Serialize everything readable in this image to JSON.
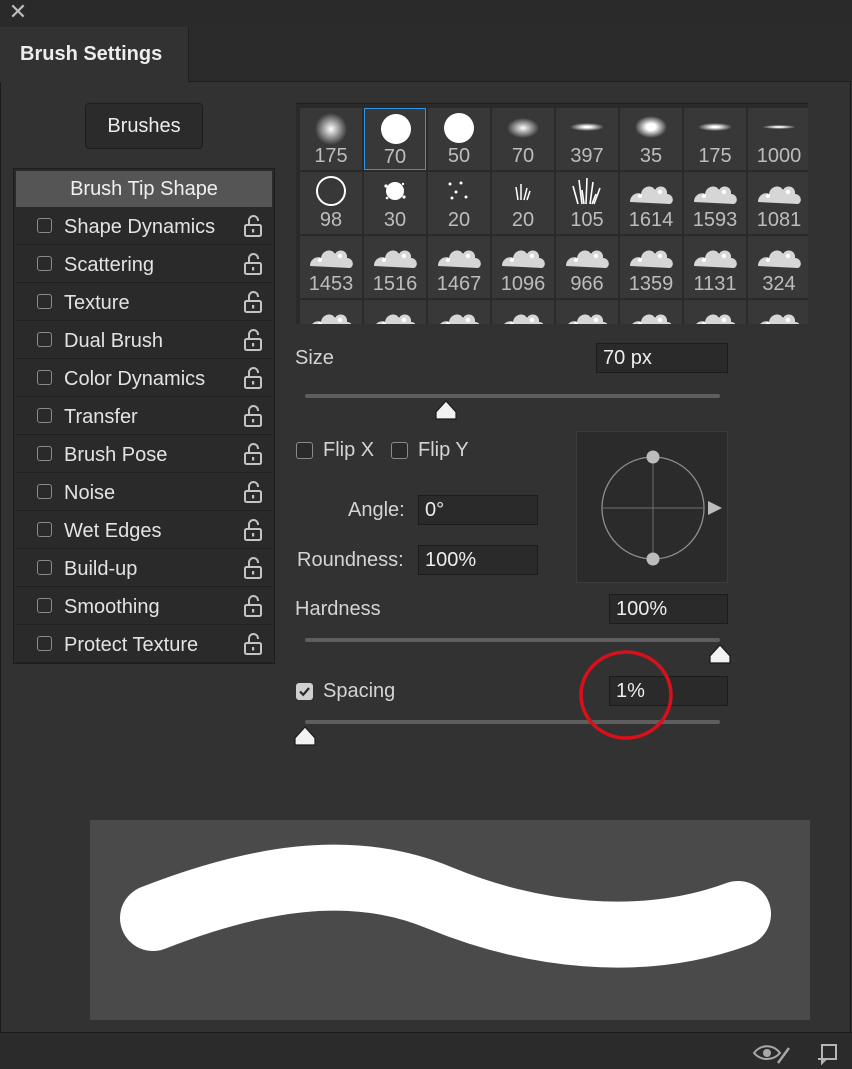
{
  "window": {
    "close_glyph": "✕",
    "tab_title": "Brush Settings"
  },
  "brushes_button": "Brushes",
  "options_list": [
    {
      "label": "Brush Tip Shape",
      "checkbox": false,
      "lock": false,
      "selected": true
    },
    {
      "label": "Shape Dynamics",
      "checkbox": true,
      "lock": true
    },
    {
      "label": "Scattering",
      "checkbox": true,
      "lock": true
    },
    {
      "label": "Texture",
      "checkbox": true,
      "lock": true
    },
    {
      "label": "Dual Brush",
      "checkbox": true,
      "lock": true
    },
    {
      "label": "Color Dynamics",
      "checkbox": true,
      "lock": true
    },
    {
      "label": "Transfer",
      "checkbox": true,
      "lock": true
    },
    {
      "label": "Brush Pose",
      "checkbox": true,
      "lock": true
    },
    {
      "label": "Noise",
      "checkbox": true,
      "lock": true
    },
    {
      "label": "Wet Edges",
      "checkbox": true,
      "lock": true
    },
    {
      "label": "Build-up",
      "checkbox": true,
      "lock": true
    },
    {
      "label": "Smoothing",
      "checkbox": true,
      "lock": true
    },
    {
      "label": "Protect Texture",
      "checkbox": true,
      "lock": true
    }
  ],
  "presets": [
    {
      "size": "175",
      "tip": "soft"
    },
    {
      "size": "70",
      "tip": "hard",
      "selected": true
    },
    {
      "size": "50",
      "tip": "hard"
    },
    {
      "size": "70",
      "tip": "soft-ellipse"
    },
    {
      "size": "397",
      "tip": "flat"
    },
    {
      "size": "35",
      "tip": "soft-ellipse-bright"
    },
    {
      "size": "175",
      "tip": "flat"
    },
    {
      "size": "1000",
      "tip": "flat-thin"
    },
    {
      "size": "98",
      "tip": "ring"
    },
    {
      "size": "30",
      "tip": "splatter"
    },
    {
      "size": "20",
      "tip": "dots"
    },
    {
      "size": "20",
      "tip": "grass-small"
    },
    {
      "size": "105",
      "tip": "grass"
    },
    {
      "size": "1614",
      "tip": "cloud"
    },
    {
      "size": "1593",
      "tip": "cloud"
    },
    {
      "size": "1081",
      "tip": "cloud"
    },
    {
      "size": "1453",
      "tip": "cloud"
    },
    {
      "size": "1516",
      "tip": "cloud"
    },
    {
      "size": "1467",
      "tip": "cloud"
    },
    {
      "size": "1096",
      "tip": "cloud"
    },
    {
      "size": "966",
      "tip": "cloud"
    },
    {
      "size": "1359",
      "tip": "cloud"
    },
    {
      "size": "1131",
      "tip": "cloud"
    },
    {
      "size": "324",
      "tip": "cloud"
    },
    {
      "size": "",
      "tip": "cloud"
    },
    {
      "size": "",
      "tip": "cloud"
    },
    {
      "size": "",
      "tip": "cloud"
    },
    {
      "size": "",
      "tip": "cloud"
    },
    {
      "size": "",
      "tip": "cloud"
    },
    {
      "size": "",
      "tip": "cloud"
    },
    {
      "size": "",
      "tip": "cloud"
    },
    {
      "size": "",
      "tip": "cloud"
    }
  ],
  "controls": {
    "size_label": "Size",
    "size_value": "70 px",
    "size_slider_fraction": 0.34,
    "flip_x_label": "Flip X",
    "flip_y_label": "Flip Y",
    "flip_x_checked": false,
    "flip_y_checked": false,
    "angle_label": "Angle:",
    "angle_value": "0°",
    "roundness_label": "Roundness:",
    "roundness_value": "100%",
    "hardness_label": "Hardness",
    "hardness_value": "100%",
    "hardness_slider_fraction": 1.0,
    "spacing_label": "Spacing",
    "spacing_checked": true,
    "spacing_value": "1%",
    "spacing_slider_fraction": 0.0
  },
  "annotation": {
    "circle_color": "#d9101a",
    "target": "spacing-value"
  },
  "colors": {
    "selection": "#2f94e3",
    "panel": "#323232"
  },
  "icons": {
    "visibility": "eye-brush-icon",
    "new_preset": "new-preset-icon"
  }
}
